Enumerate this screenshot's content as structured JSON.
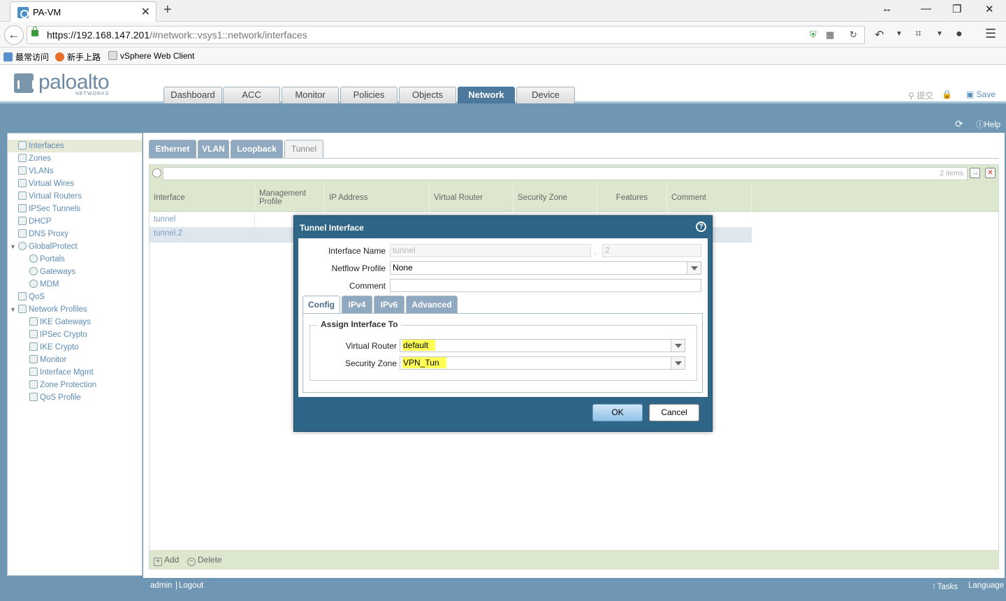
{
  "browser": {
    "tab_title": "PA-VM",
    "url_host": "https://192.168.147.201",
    "url_path": "/#network::vsys1::network/interfaces",
    "bookmarks": [
      "最常访问",
      "新手上路",
      "vSphere Web Client"
    ]
  },
  "header": {
    "logo_word": "paloalto",
    "logo_sub": "NETWORKS",
    "tabs": [
      "Dashboard",
      "ACC",
      "Monitor",
      "Policies",
      "Objects",
      "Network",
      "Device"
    ],
    "active_tab": "Network",
    "commit_label": "提交",
    "save_label": "Save"
  },
  "sidebar": {
    "items": [
      {
        "label": "Interfaces",
        "selected": true,
        "icon": "interfaces-icon"
      },
      {
        "label": "Zones",
        "icon": "zones-icon"
      },
      {
        "label": "VLANs",
        "icon": "vlans-icon"
      },
      {
        "label": "Virtual Wires",
        "icon": "virtual-wires-icon"
      },
      {
        "label": "Virtual Routers",
        "icon": "virtual-routers-icon"
      },
      {
        "label": "IPSec Tunnels",
        "icon": "ipsec-tunnels-icon"
      },
      {
        "label": "DHCP",
        "icon": "dhcp-icon"
      },
      {
        "label": "DNS Proxy",
        "icon": "dns-proxy-icon"
      },
      {
        "label": "GlobalProtect",
        "icon": "globalprotect-icon"
      },
      {
        "label": "Portals",
        "icon": "portals-icon"
      },
      {
        "label": "Gateways",
        "icon": "gateways-icon"
      },
      {
        "label": "MDM",
        "icon": "mdm-icon"
      },
      {
        "label": "QoS",
        "icon": "qos-icon"
      },
      {
        "label": "Network Profiles",
        "icon": "network-profiles-icon"
      },
      {
        "label": "IKE Gateways",
        "icon": "ike-gateways-icon"
      },
      {
        "label": "IPSec Crypto",
        "icon": "lock-icon"
      },
      {
        "label": "IKE Crypto",
        "icon": "lock-icon"
      },
      {
        "label": "Monitor",
        "icon": "monitor-icon"
      },
      {
        "label": "Interface Mgmt",
        "icon": "interface-mgmt-icon"
      },
      {
        "label": "Zone Protection",
        "icon": "zone-protection-icon"
      },
      {
        "label": "QoS Profile",
        "icon": "qos-profile-icon"
      }
    ]
  },
  "content": {
    "help_label": "Help",
    "subtabs": [
      "Ethernet",
      "VLAN",
      "Loopback",
      "Tunnel"
    ],
    "active_subtab": "Tunnel",
    "items_count": "2 items",
    "columns": [
      "Interface",
      "Management Profile",
      "IP Address",
      "Virtual Router",
      "Security Zone",
      "Features",
      "Comment"
    ],
    "rows": [
      {
        "interface": "tunnel"
      },
      {
        "interface": "tunnel.2"
      }
    ],
    "add_label": "Add",
    "delete_label": "Delete",
    "status_user": "admin",
    "status_logout": "Logout",
    "tasks_label": "Tasks",
    "language_label": "Language"
  },
  "modal": {
    "title": "Tunnel Interface",
    "interface_name_label": "Interface Name",
    "interface_name_value": "tunnel",
    "interface_suffix_value": "2",
    "netflow_label": "Netflow Profile",
    "netflow_value": "None",
    "comment_label": "Comment",
    "comment_value": "",
    "tabs": [
      "Config",
      "IPv4",
      "IPv6",
      "Advanced"
    ],
    "active_tab": "Config",
    "fieldset_legend": "Assign Interface To",
    "virtual_router_label": "Virtual Router",
    "virtual_router_value": "default",
    "security_zone_label": "Security Zone",
    "security_zone_value": "VPN_Tun",
    "ok_label": "OK",
    "cancel_label": "Cancel"
  },
  "colors": {
    "accent_blue": "#2f6587",
    "body_blue": "#6f97b4",
    "grid_green": "#dde7ce",
    "highlight_yellow": "#ffff55"
  }
}
